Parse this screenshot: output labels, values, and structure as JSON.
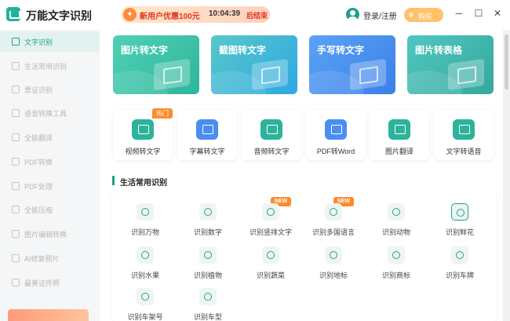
{
  "app": {
    "title": "万能文字识别"
  },
  "promo": {
    "text": "新用户优惠100元",
    "timer": "10:04:39",
    "suffix": "后结束"
  },
  "header": {
    "login": "登录/注册",
    "vip": "购买VIP"
  },
  "window": {
    "minimize": "─",
    "maximize": "☐",
    "close": "✕"
  },
  "sidebar": {
    "items": [
      {
        "label": "文字识别",
        "active": true
      },
      {
        "label": "生活常用识别"
      },
      {
        "label": "票证识别"
      },
      {
        "label": "语音转换工具"
      },
      {
        "label": "全能翻译"
      },
      {
        "label": "PDF转换"
      },
      {
        "label": "PDF处理"
      },
      {
        "label": "全能压缩"
      },
      {
        "label": "图片编辑转换"
      },
      {
        "label": "AI修复照片"
      },
      {
        "label": "最美证件照"
      }
    ]
  },
  "cards": [
    {
      "title": "图片转文字",
      "color": "#35c2a8"
    },
    {
      "title": "截图转文字",
      "color": "#3fa7f0"
    },
    {
      "title": "手写转文字",
      "color": "#4a8ef2"
    },
    {
      "title": "图片转表格",
      "color": "#3fb8ad"
    }
  ],
  "tools": [
    {
      "label": "视频转文字",
      "badge": "热门",
      "color": "#2db39b"
    },
    {
      "label": "字幕转文字",
      "color": "#4a8ef2"
    },
    {
      "label": "音频转文字",
      "color": "#2db39b"
    },
    {
      "label": "PDF转Word",
      "color": "#4a8ef2"
    },
    {
      "label": "图片翻译",
      "color": "#2db39b"
    },
    {
      "label": "文字转语音",
      "color": "#2db39b"
    }
  ],
  "section": {
    "title": "生活常用识别"
  },
  "recognitions": [
    {
      "label": "识别万物"
    },
    {
      "label": "识别数字"
    },
    {
      "label": "识别竖排文字",
      "badge": "NEW"
    },
    {
      "label": "识别多国语言",
      "badge": "NEW"
    },
    {
      "label": "识别动物"
    },
    {
      "label": "识别鲜花",
      "framed": true
    },
    {
      "label": "识别水果"
    },
    {
      "label": "识别植物"
    },
    {
      "label": "识别蔬菜"
    },
    {
      "label": "识别地标"
    },
    {
      "label": "识别商标"
    },
    {
      "label": "识别车牌"
    },
    {
      "label": "识别车架号"
    },
    {
      "label": "识别车型"
    }
  ]
}
